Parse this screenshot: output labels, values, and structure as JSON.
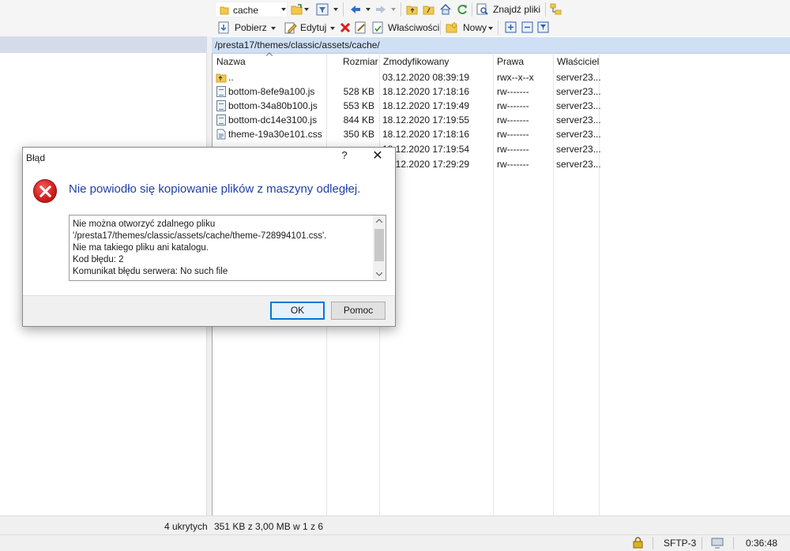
{
  "toolbar_top": {
    "path_combo_value": "cache",
    "find_files_label": "Znajdź pliki"
  },
  "toolbar_second": {
    "download_label": "Pobierz",
    "edit_label": "Edytuj",
    "properties_label": "Właściwości",
    "new_label": "Nowy"
  },
  "remote_panel": {
    "path": "/presta17/themes/classic/assets/cache/",
    "columns": [
      "Nazwa",
      "Rozmiar",
      "Zmodyfikowany",
      "Prawa",
      "Właściciel"
    ],
    "rows": [
      {
        "name": "..",
        "size": "",
        "modified": "03.12.2020 08:39:19",
        "rights": "rwx--x--x",
        "owner": "server23..."
      },
      {
        "name": "bottom-8efe9a100.js",
        "size": "528 KB",
        "modified": "18.12.2020 17:18:16",
        "rights": "rw-------",
        "owner": "server23..."
      },
      {
        "name": "bottom-34a80b100.js",
        "size": "553 KB",
        "modified": "18.12.2020 17:19:49",
        "rights": "rw-------",
        "owner": "server23..."
      },
      {
        "name": "bottom-dc14e3100.js",
        "size": "844 KB",
        "modified": "18.12.2020 17:19:55",
        "rights": "rw-------",
        "owner": "server23..."
      },
      {
        "name": "theme-19a30e101.css",
        "size": "350 KB",
        "modified": "18.12.2020 17:18:16",
        "rights": "rw-------",
        "owner": "server23..."
      },
      {
        "name": "",
        "size": "",
        "modified": "18.12.2020 17:19:54",
        "rights": "rw-------",
        "owner": "server23..."
      },
      {
        "name": "",
        "size": "",
        "modified": "18.12.2020 17:29:29",
        "rights": "rw-------",
        "owner": "server23..."
      }
    ]
  },
  "status_bar": {
    "hidden_count": "4 ukrytych",
    "selection_info": "351 KB z 3,00 MB w 1 z 6",
    "protocol": "SFTP-3",
    "time": "0:36:48"
  },
  "dialog": {
    "title": "Błąd",
    "help_glyph": "?",
    "close_glyph": "✕",
    "heading": "Nie powiodło się kopiowanie plików z maszyny odległej.",
    "message_lines": [
      "Nie można otworzyć zdalnego pliku",
      "'/presta17/themes/classic/assets/cache/theme-728994101.css'.",
      "Nie ma takiego pliku ani katalogu.",
      "Kod błędu: 2",
      "Komunikat błędu serwera: No such file"
    ],
    "ok_label": "OK",
    "help_label": "Pomoc"
  }
}
